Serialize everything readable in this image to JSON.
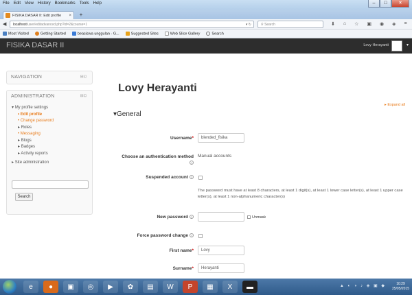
{
  "browser": {
    "menu": [
      "File",
      "Edit",
      "View",
      "History",
      "Bookmarks",
      "Tools",
      "Help"
    ],
    "tab_title": "FISIKA DASAR II: Edit profile",
    "tab_close": "×",
    "new_tab": "+",
    "url_host": "localhost",
    "url_path": "/user/editadvanced.php?id=2&course=1",
    "search_placeholder": "Search",
    "bookmarks": [
      "Most Visited",
      "Getting Started",
      "beasiswa unggulan - G...",
      "Suggested Sites",
      "Web Slice Gallery",
      "Search"
    ]
  },
  "header": {
    "site_name": "FISIKA DASAR II",
    "user_name": "Lovy Herayanti"
  },
  "navigation_block": {
    "title": "NAVIGATION",
    "controls": "⊟⊡"
  },
  "admin_block": {
    "title": "ADMINISTRATION",
    "controls": "⊟⊡",
    "my_profile_settings": "My profile settings",
    "items": [
      "Edit profile",
      "Change password",
      "Roles",
      "Messaging",
      "Blogs",
      "Badges",
      "Activity reports"
    ],
    "site_administration": "Site administration",
    "search_button": "Search"
  },
  "main": {
    "heading": "Lovy Herayanti",
    "expand_all": "Expand all",
    "section": "General",
    "fields": {
      "username_label": "Username",
      "username_value": "blended_fisika",
      "auth_label": "Choose an authentication method",
      "auth_value": "Manual accounts",
      "suspended_label": "Suspended account",
      "password_note": "The password must have at least 8 characters, at least 1 digit(s), at least 1 lower case letter(s), at least 1 upper case letter(s), at least 1 non-alphanumeric character(s)",
      "new_password_label": "New password",
      "unmask_label": "Unmask",
      "force_change_label": "Force password change",
      "firstname_label": "First name",
      "firstname_value": "Lovy",
      "surname_label": "Surname",
      "surname_value": "Herayanti"
    }
  },
  "taskbar": {
    "time": "10:29",
    "date": "25/05/2015"
  }
}
